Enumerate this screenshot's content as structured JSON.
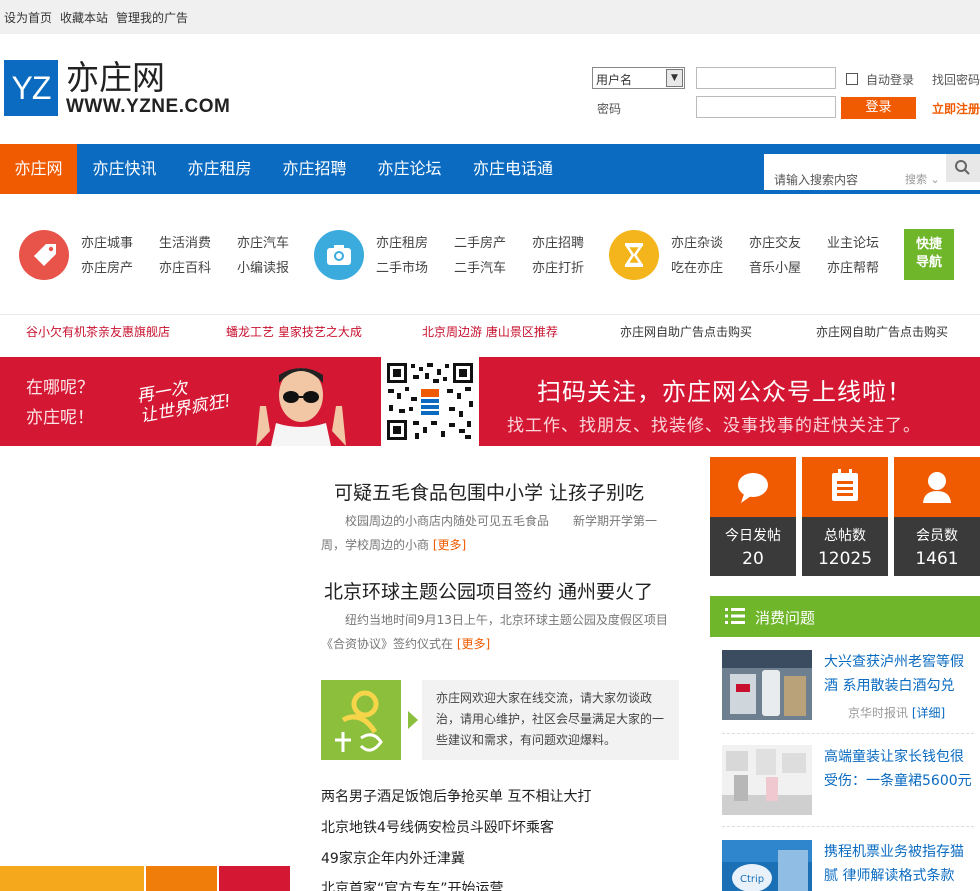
{
  "topbar": {
    "links": [
      "设为首页",
      "收藏本站",
      "管理我的广告"
    ]
  },
  "logo": {
    "mark": "YZ",
    "name": "亦庄网",
    "domain": "WWW.YZNE.COM"
  },
  "login": {
    "select_value": "用户名",
    "password_label": "密码",
    "auto_login": "自动登录",
    "find_password": "找回密码",
    "login_button": "登录",
    "register": "立即注册"
  },
  "nav": {
    "items": [
      "亦庄网",
      "亦庄快讯",
      "亦庄租房",
      "亦庄招聘",
      "亦庄论坛",
      "亦庄电话通"
    ],
    "search_placeholder": "请输入搜索内容",
    "search_type": "搜索"
  },
  "quick_nav": {
    "group1": [
      "亦庄城事",
      "生活消费",
      "亦庄汽车",
      "亦庄房产",
      "亦庄百科",
      "小编读报"
    ],
    "group2": [
      "亦庄租房",
      "二手房产",
      "亦庄招聘",
      "二手市场",
      "二手汽车",
      "亦庄打折"
    ],
    "group3": [
      "亦庄杂谈",
      "亦庄交友",
      "业主论坛",
      "吃在亦庄",
      "音乐小屋",
      "亦庄帮帮"
    ],
    "fast_line1": "快捷",
    "fast_line2": "导航",
    "colors": {
      "icon1": "#e8544a",
      "icon2": "#3aabdc",
      "icon3": "#f3b51b"
    }
  },
  "text_ads": [
    {
      "text": "谷小欠有机茶亲友惠旗舰店",
      "color": "#c8102e"
    },
    {
      "text": "蟠龙工艺 皇家技艺之大成",
      "color": "#c8102e"
    },
    {
      "text": "北京周边游 唐山景区推荐",
      "color": "#c8102e"
    },
    {
      "text": "亦庄网自助广告点击购买",
      "color": "#333333"
    },
    {
      "text": "亦庄网自助广告点击购买",
      "color": "#333333"
    }
  ],
  "banner": {
    "where_line1": "在哪呢？",
    "where_line2": "亦庄呢！",
    "slogan_line1": "再一次",
    "slogan_line2": "让世界疯狂!",
    "headline": "扫码关注，亦庄网公众号上线啦！",
    "subline": "找工作、找朋友、找装修、没事找事的赶快关注了。"
  },
  "articles": [
    {
      "title": "可疑五毛食品包围中小学 让孩子别吃",
      "summary_line1": "校园周边的小商店内随处可见五毛食品　　新学期开学第一",
      "summary_line2": "周，学校周边的小商",
      "more": "[更多]"
    },
    {
      "title": "北京环球主题公园项目签约 通州要火了",
      "summary_line1": "纽约当地时间9月13日上午，北京环球主题公园及度假区项目",
      "summary_line2": "《合资协议》签约仪式在",
      "more": "[更多]"
    }
  ],
  "zhidao": {
    "text": "亦庄网欢迎大家在线交流，请大家勿谈政治，请用心维护，社区会尽量满足大家的一些建议和需求，有问题欢迎爆料。"
  },
  "headlines": [
    "两名男子酒足饭饱后争抢买单 互不相让大打",
    "北京地铁4号线俩安检员斗殴吓坏乘客",
    "49家京企年内外迁津冀",
    "北京首家“官方专车”开始运营"
  ],
  "stats": [
    {
      "label": "今日发帖",
      "value": "20",
      "icon": "chat-bubble-icon"
    },
    {
      "label": "总帖数",
      "value": "12025",
      "icon": "document-icon"
    },
    {
      "label": "会员数",
      "value": "1461",
      "icon": "user-icon"
    }
  ],
  "consume": {
    "title": "消费问题",
    "items": [
      {
        "title": "大兴查获泸州老窖等假酒 系用散装白酒勾兑",
        "source": "京华时报讯",
        "more": "[详细]"
      },
      {
        "title": "高端童装让家长钱包很受伤：一条童裙5600元",
        "source": "",
        "more": ""
      },
      {
        "title": "携程机票业务被指存猫腻 律师解读格式条款",
        "source": "",
        "more": ""
      }
    ]
  }
}
